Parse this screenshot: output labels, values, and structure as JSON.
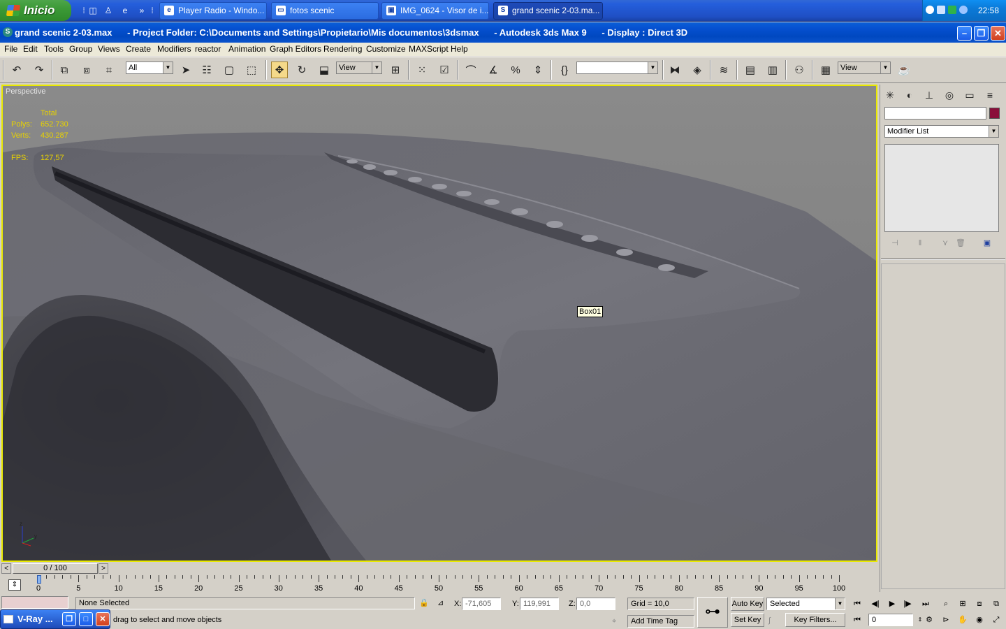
{
  "taskbar": {
    "start_label": "Inicio",
    "tasks": [
      {
        "label": "Player Radio - Windo...",
        "icon": "ie-icon"
      },
      {
        "label": "fotos scenic",
        "icon": "folder-icon"
      },
      {
        "label": "IMG_0624 - Visor de i...",
        "icon": "image-viewer-icon"
      },
      {
        "label": "grand scenic 2-03.ma...",
        "icon": "3dsmax-icon"
      }
    ],
    "clock": "22:58"
  },
  "window": {
    "title": "grand scenic 2-03.max      - Project Folder: C:\\Documents and Settings\\Propietario\\Mis documentos\\3dsmax      - Autodesk 3ds Max 9      - Display : Direct 3D"
  },
  "menu": [
    "File",
    "Edit",
    "Tools",
    "Group",
    "Views",
    "Create",
    "Modifiers",
    "reactor",
    "Animation",
    "Graph Editors",
    "Rendering",
    "Customize",
    "MAXScript",
    "Help"
  ],
  "toolbar": {
    "selection_filter": "All",
    "ref_coord": "View",
    "named_selection": "",
    "render_view": "View"
  },
  "viewport": {
    "label": "Perspective",
    "stats_header": "Total",
    "polys_label": "Polys:",
    "polys_value": "652.730",
    "verts_label": "Verts:",
    "verts_value": "430.287",
    "fps_label": "FPS:",
    "fps_value": "127,57",
    "object_tooltip": "Box01"
  },
  "command_panel": {
    "modifier_list": "Modifier List",
    "color": "#8a0f3a"
  },
  "time_slider": {
    "position": "0 / 100"
  },
  "trackbar": {
    "ticks": [
      "0",
      "5",
      "10",
      "15",
      "20",
      "25",
      "30",
      "35",
      "40",
      "45",
      "50",
      "55",
      "60",
      "65",
      "70",
      "75",
      "80",
      "85",
      "90",
      "95",
      "100"
    ]
  },
  "status": {
    "selection": "None Selected",
    "prompt": "drag to select and move objects",
    "x_label": "X:",
    "x_value": "-71,605",
    "y_label": "Y:",
    "y_value": "119,991",
    "z_label": "Z:",
    "z_value": "0,0",
    "grid": "Grid = 10,0",
    "add_time_tag": "Add Time Tag",
    "auto_key": "Auto Key",
    "set_key": "Set Key",
    "key_mode": "Selected",
    "key_filters": "Key Filters...",
    "frame": "0"
  },
  "vray_task": {
    "label": "V-Ray ..."
  }
}
